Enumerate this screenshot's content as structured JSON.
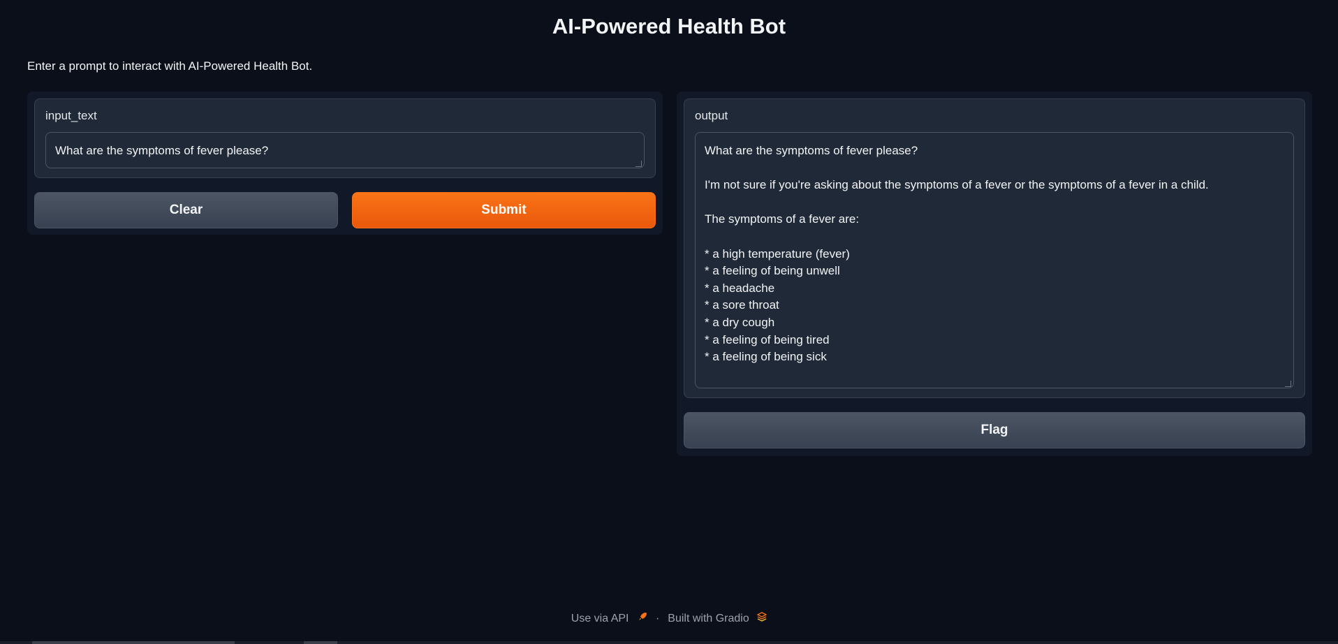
{
  "app": {
    "title": "AI-Powered Health Bot",
    "description": "Enter a prompt to interact with AI-Powered Health Bot."
  },
  "input": {
    "label": "input_text",
    "value": "What are the symptoms of fever please?"
  },
  "buttons": {
    "clear": "Clear",
    "submit": "Submit",
    "flag": "Flag"
  },
  "output": {
    "label": "output",
    "value": "What are the symptoms of fever please?\n\nI'm not sure if you're asking about the symptoms of a fever or the symptoms of a fever in a child.\n\nThe symptoms of a fever are:\n\n* a high temperature (fever)\n* a feeling of being unwell\n* a headache\n* a sore throat\n* a dry cough\n* a feeling of being tired\n* a feeling of being sick"
  },
  "footer": {
    "api_link": "Use via API",
    "separator": "·",
    "built_with": "Built with Gradio"
  },
  "colors": {
    "background": "#0b0f19",
    "primary": "#f97316",
    "secondary": "#4b5563"
  },
  "icons": {
    "api": "rocket-icon",
    "gradio": "gradio-logo-icon"
  }
}
